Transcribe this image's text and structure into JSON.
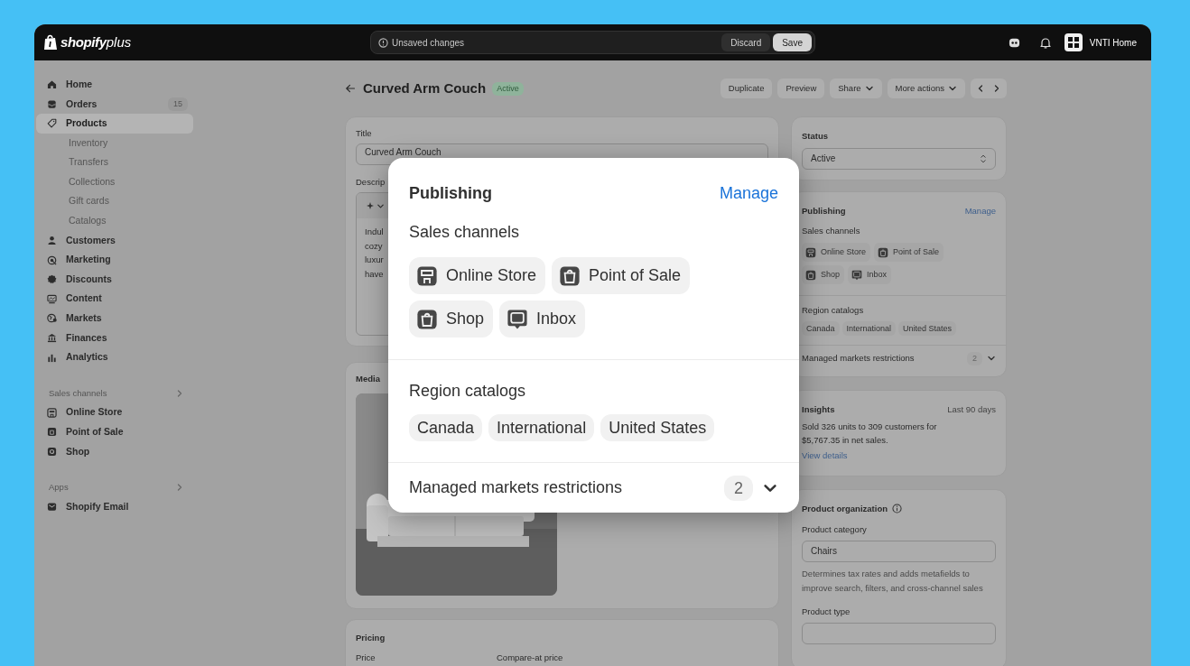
{
  "topbar": {
    "logo": "shopify",
    "logo_suffix": "plus",
    "unsaved": "Unsaved changes",
    "discard": "Discard",
    "save": "Save",
    "store": "VNTI Home"
  },
  "sidebar": {
    "items": [
      {
        "label": "Home",
        "selected": false
      },
      {
        "label": "Orders",
        "badge": "15",
        "selected": false
      },
      {
        "label": "Products",
        "selected": true,
        "children": [
          {
            "label": "Inventory",
            "selected": false
          },
          {
            "label": "Transfers",
            "selected": false
          },
          {
            "label": "Collections",
            "selected": false
          },
          {
            "label": "Gift cards",
            "selected": false
          },
          {
            "label": "Catalogs",
            "selected": false
          }
        ]
      },
      {
        "label": "Customers",
        "selected": false
      },
      {
        "label": "Marketing",
        "selected": false
      },
      {
        "label": "Discounts",
        "selected": false
      },
      {
        "label": "Content",
        "selected": false
      },
      {
        "label": "Markets",
        "selected": false
      },
      {
        "label": "Finances",
        "selected": false
      },
      {
        "label": "Analytics",
        "selected": false
      }
    ],
    "sections": [
      {
        "title": "Sales channels",
        "items": [
          {
            "label": "Online Store",
            "selected": false
          },
          {
            "label": "Point of Sale",
            "selected": false
          },
          {
            "label": "Shop",
            "selected": false
          }
        ]
      },
      {
        "title": "Apps",
        "items": [
          {
            "label": "Shopify Email",
            "selected": false
          }
        ]
      }
    ]
  },
  "header": {
    "title": "Curved Arm Couch",
    "status": "Active",
    "actions": [
      {
        "label": "Duplicate",
        "has_menu": false
      },
      {
        "label": "Preview",
        "has_menu": false
      },
      {
        "label": "Share",
        "has_menu": true
      },
      {
        "label": "More actions",
        "has_menu": true
      }
    ]
  },
  "title_card": {
    "title_label": "Title",
    "title_value": "Curved Arm Couch",
    "description_label": "Descrip",
    "description_lines": [
      "Indul",
      "cozy",
      "luxur",
      "have"
    ]
  },
  "media_card": {
    "label": "Media"
  },
  "pricing_card": {
    "label": "Pricing",
    "fields": [
      "Price",
      "Compare-at price"
    ]
  },
  "status_card": {
    "label": "Status",
    "value": "Active"
  },
  "publishing_card": {
    "title": "Publishing",
    "manage": "Manage",
    "sales_label": "Sales channels",
    "channels": [
      "Online Store",
      "Point of Sale",
      "Shop",
      "Inbox"
    ],
    "region_label": "Region catalogs",
    "regions": [
      "Canada",
      "International",
      "United States"
    ],
    "restrictions": {
      "label": "Managed markets restrictions",
      "count": "2",
      "expanded": false
    }
  },
  "insights_card": {
    "title": "Insights",
    "period": "Last 90 days",
    "text": "Sold 326 units to 309 customers for $5,767.35 in net sales.",
    "link": "View details"
  },
  "organization_card": {
    "title": "Product organization",
    "category_label": "Product category",
    "category_value": "Chairs",
    "help": "Determines tax rates and adds metafields to improve search, filters, and cross-channel sales",
    "type_label": "Product type"
  },
  "popup": {
    "title": "Publishing",
    "manage": "Manage",
    "sales_label": "Sales channels",
    "channels": [
      "Online Store",
      "Point of Sale",
      "Shop",
      "Inbox"
    ],
    "region_label": "Region catalogs",
    "regions": [
      "Canada",
      "International",
      "United States"
    ],
    "restrictions": {
      "label": "Managed markets restrictions",
      "count": "2",
      "expanded": false
    }
  }
}
